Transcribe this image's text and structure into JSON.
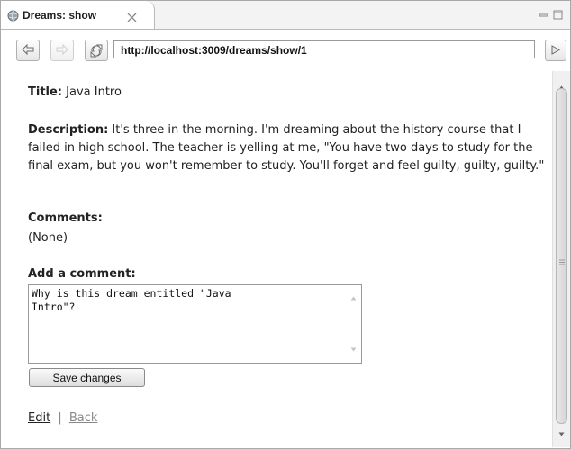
{
  "tab": {
    "title": "Dreams: show"
  },
  "toolbar": {
    "url": "http://localhost:3009/dreams/show/1"
  },
  "page": {
    "title_label": "Title:",
    "title_value": "Java Intro",
    "description_label": "Description:",
    "description_value": "It's three in the morning. I'm dreaming about the history course that I failed in high school. The teacher is yelling at me, \"You have two days to study for the final exam, but you won't remember to study. You'll forget and feel guilty, guilty, guilty.\"",
    "comments_label": "Comments:",
    "comments_value": "(None)",
    "add_comment_label": "Add a comment:",
    "comment_text": "Why is this dream entitled \"Java\nIntro\"?",
    "save_button": "Save changes",
    "edit_link": "Edit",
    "separator": "|",
    "back_link": "Back"
  }
}
